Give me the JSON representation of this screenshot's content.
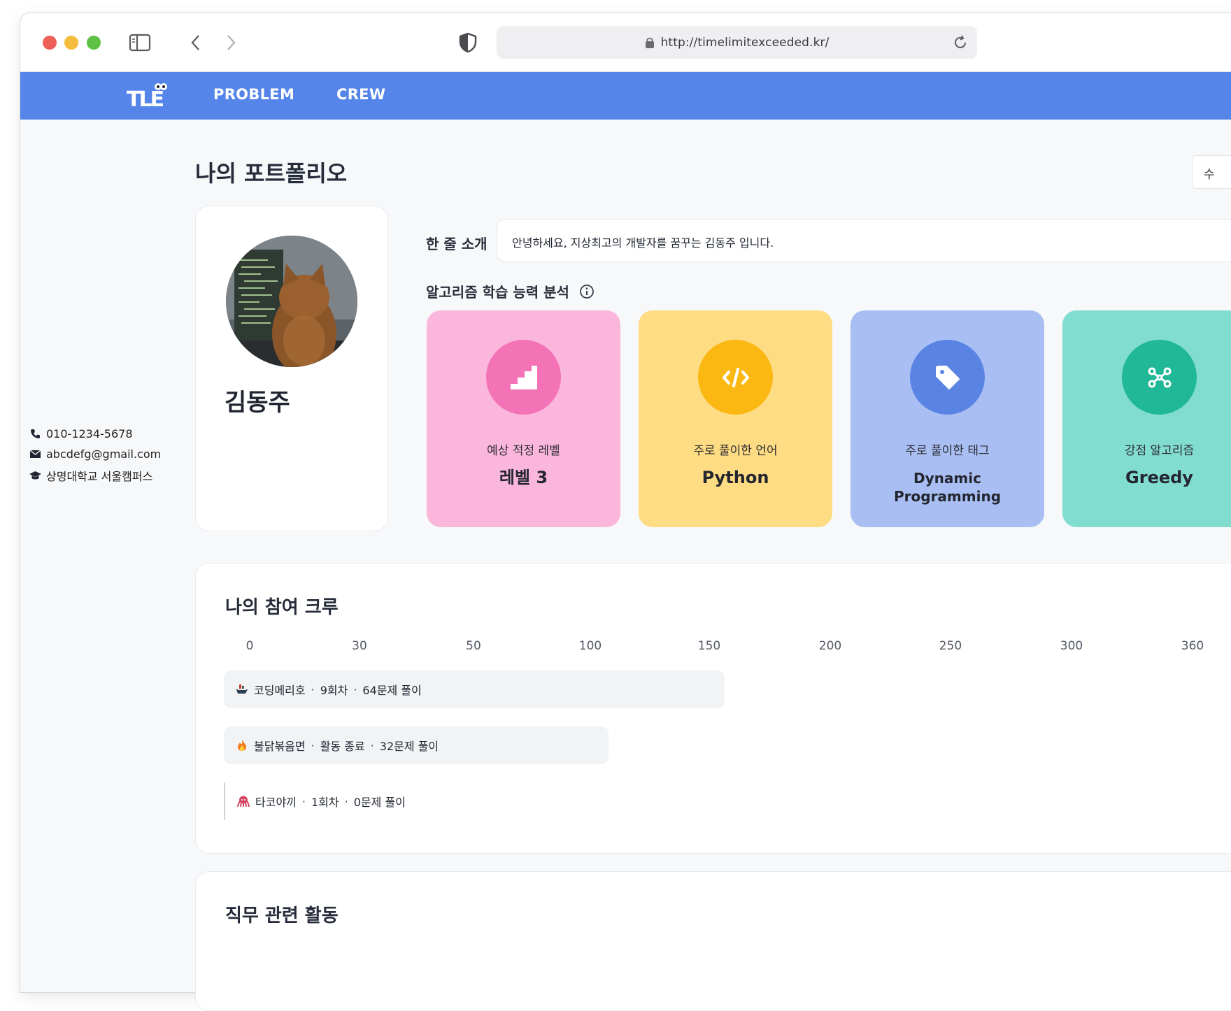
{
  "browser": {
    "url": "http://timelimitexceeded.kr/"
  },
  "nav": {
    "logo_text": "TLE",
    "problem_label": "PROBLEM",
    "crew_label": "CREW"
  },
  "page": {
    "title": "나의 포트폴리오",
    "edit_label": "수"
  },
  "profile": {
    "name": "김동주",
    "phone": "010-1234-5678",
    "email": "abcdefg@gmail.com",
    "school": "상명대학교 서울캠퍼스"
  },
  "intro": {
    "label": "한 줄 소개",
    "text": "안녕하세요, 지상최고의 개발자를 꿈꾸는 김동주 입니다."
  },
  "analysis": {
    "label": "알고리즘 학습 능력 분석",
    "cards": [
      {
        "caption": "예상 적정 레벨",
        "value": "레벨 3",
        "icon": "stairs-icon",
        "color": "#fbb6dc",
        "accent": "#f472b6"
      },
      {
        "caption": "주로 풀이한 언어",
        "value": "Python",
        "icon": "code-icon",
        "color": "#fedc83",
        "accent": "#fbb712"
      },
      {
        "caption": "주로 풀이한 태그",
        "value_line1": "Dynamic",
        "value_line2": "Programming",
        "icon": "tag-icon",
        "color": "#a9bff4",
        "accent": "#5a84e4"
      },
      {
        "caption": "강점 알고리즘",
        "value": "Greedy",
        "icon": "graph-icon",
        "color": "#82ddd1",
        "accent": "#20b896"
      }
    ]
  },
  "crew": {
    "title": "나의 참여 크루",
    "axis_ticks": [
      "0",
      "30",
      "50",
      "100",
      "150",
      "200",
      "250",
      "300",
      "360"
    ],
    "items": [
      {
        "name": "코딩메리호",
        "status": "9회차",
        "solved": "64문제 풀이",
        "solved_count": 64,
        "icon": "ship-icon"
      },
      {
        "name": "불닭볶음면",
        "status": "활동 종료",
        "solved": "32문제 풀이",
        "solved_count": 32,
        "icon": "fire-icon"
      },
      {
        "name": "타코야끼",
        "status": "1회차",
        "solved": "0문제 풀이",
        "solved_count": 0,
        "icon": "octopus-icon"
      }
    ]
  },
  "job": {
    "title": "직무 관련 활동"
  },
  "colors": {
    "brand": "#5585e9"
  }
}
